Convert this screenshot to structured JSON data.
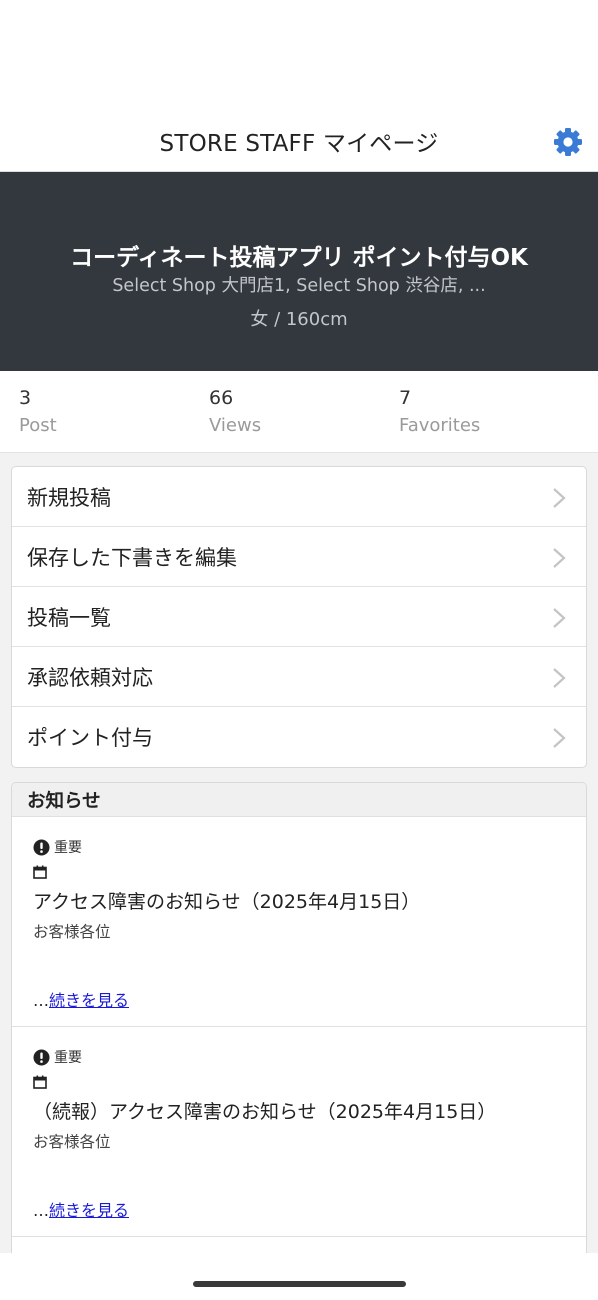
{
  "header": {
    "title": "STORE STAFF マイページ",
    "settings_icon": "gear-icon",
    "accent_color": "#3a7bd5"
  },
  "profile": {
    "name": "コーディネート投稿アプリ ポイント付与OK",
    "shops": "Select Shop 大門店1, Select Shop 渋谷店, ...",
    "attributes": "女 / 160cm"
  },
  "stats": [
    {
      "value": "3",
      "label": "Post"
    },
    {
      "value": "66",
      "label": "Views"
    },
    {
      "value": "7",
      "label": "Favorites"
    }
  ],
  "menu": [
    {
      "label": "新規投稿"
    },
    {
      "label": "保存した下書きを編集"
    },
    {
      "label": "投稿一覧"
    },
    {
      "label": "承認依頼対応"
    },
    {
      "label": "ポイント付与"
    }
  ],
  "news": {
    "heading": "お知らせ",
    "items": [
      {
        "badge": "重要",
        "title": "アクセス障害のお知らせ（2025年4月15日）",
        "body": "お客様各位",
        "ellipsis": "…",
        "read_more": "続きを見る"
      },
      {
        "badge": "重要",
        "title": "（続報）アクセス障害のお知らせ（2025年4月15日）",
        "body": "お客様各位",
        "ellipsis": "…",
        "read_more": "続きを見る"
      }
    ]
  }
}
